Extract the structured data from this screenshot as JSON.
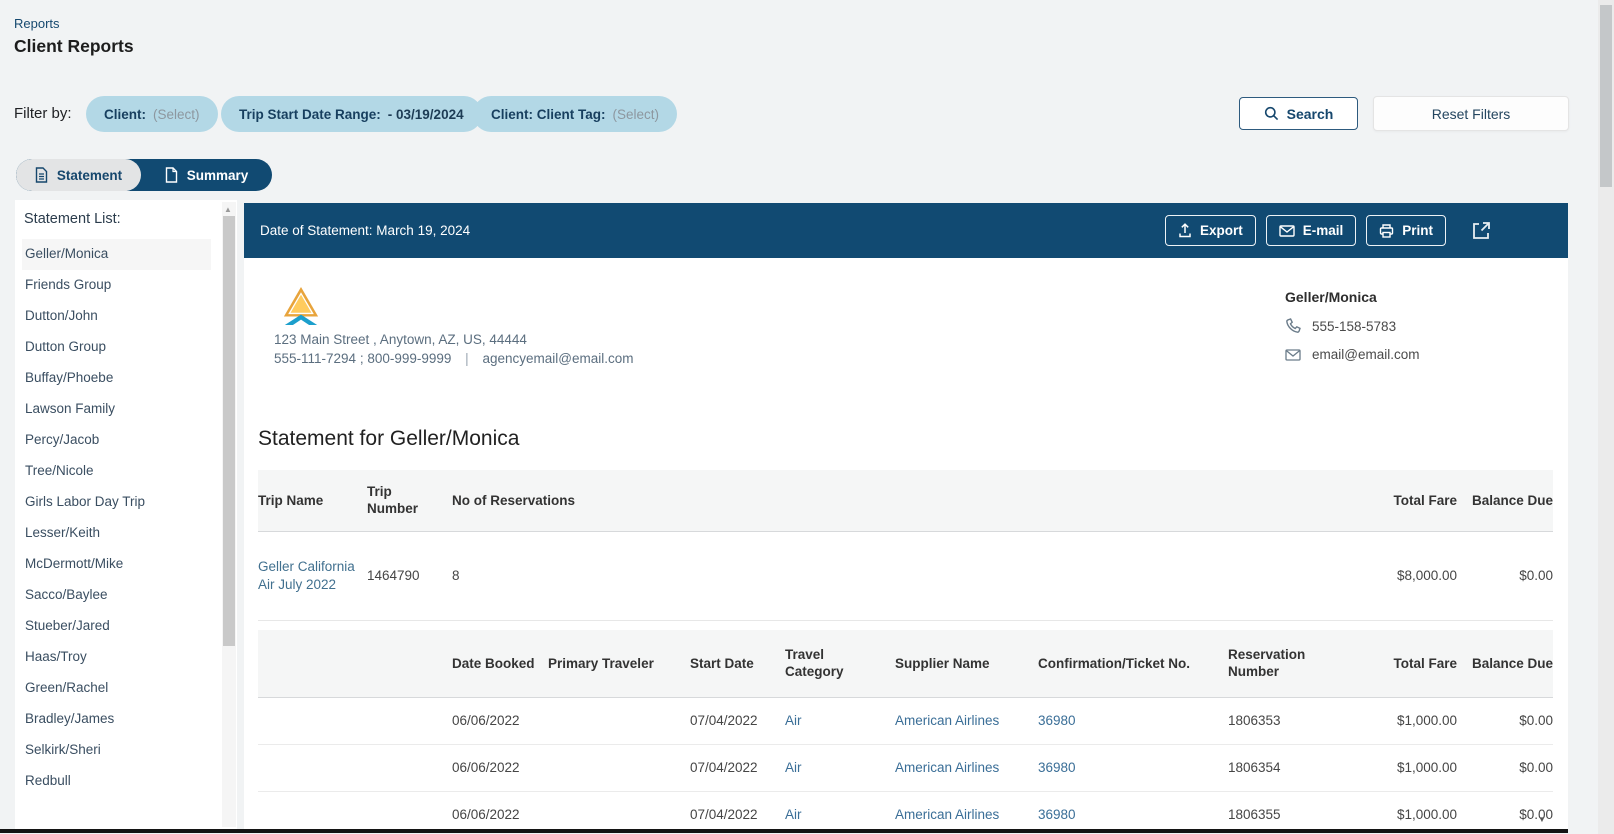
{
  "page": {
    "breadcrumb": "Reports",
    "title": "Client Reports"
  },
  "filters": {
    "label": "Filter by:",
    "client_chip": {
      "label": "Client:",
      "value": "(Select)"
    },
    "date_chip": {
      "label": "Trip Start Date Range:",
      "value": "- 03/19/2024"
    },
    "tag_chip": {
      "label": "Client: Client Tag:",
      "value": "(Select)"
    },
    "search": "Search",
    "reset": "Reset Filters"
  },
  "tabs": {
    "statement": "Statement",
    "summary": "Summary"
  },
  "sidebar": {
    "heading": "Statement List:",
    "selected": "Geller/Monica",
    "items": [
      "Geller/Monica",
      "Friends Group",
      "Dutton/John",
      "Dutton Group",
      "Buffay/Phoebe",
      "Lawson Family",
      "Percy/Jacob",
      "Tree/Nicole",
      "Girls Labor Day Trip",
      "Lesser/Keith",
      "McDermott/Mike",
      "Sacco/Baylee",
      "Stueber/Jared",
      "Haas/Troy",
      "Green/Rachel",
      "Bradley/James",
      "Selkirk/Sheri",
      "Redbull"
    ]
  },
  "statement": {
    "bar": {
      "date": "Date of Statement: March 19, 2024",
      "export": "Export",
      "email": "E-mail",
      "print": "Print"
    },
    "agency": {
      "address": "123 Main Street , Anytown, AZ, US, 44444",
      "phones": "555-111-7294 ; 800-999-9999",
      "separator": "|",
      "email": "agencyemail@email.com"
    },
    "client": {
      "name": "Geller/Monica",
      "phone": "555-158-5783",
      "email": "email@email.com"
    },
    "title": "Statement for Geller/Monica",
    "trip_table": {
      "headers": {
        "trip_name": "Trip Name",
        "trip_number": "Trip Number",
        "reservations": "No of Reservations",
        "total_fare": "Total Fare",
        "balance_due": "Balance Due"
      },
      "row": {
        "trip_name": "Geller California Air July 2022",
        "trip_number": "1464790",
        "reservations": "8",
        "total_fare": "$8,000.00",
        "balance_due": "$0.00"
      }
    },
    "res_table": {
      "headers": {
        "date_booked": "Date Booked",
        "primary_traveler": "Primary Traveler",
        "start_date": "Start Date",
        "travel_category": "Travel Category",
        "supplier": "Supplier Name",
        "confirmation": "Confirmation/Ticket No.",
        "res_number": "Reservation Number",
        "total_fare": "Total Fare",
        "balance_due": "Balance Due"
      },
      "rows": [
        {
          "date_booked": "06/06/2022",
          "primary_traveler": "",
          "start_date": "07/04/2022",
          "travel_category": "Air",
          "supplier": "American Airlines",
          "confirmation": "36980",
          "res_number": "1806353",
          "total_fare": "$1,000.00",
          "balance_due": "$0.00"
        },
        {
          "date_booked": "06/06/2022",
          "primary_traveler": "",
          "start_date": "07/04/2022",
          "travel_category": "Air",
          "supplier": "American Airlines",
          "confirmation": "36980",
          "res_number": "1806354",
          "total_fare": "$1,000.00",
          "balance_due": "$0.00"
        },
        {
          "date_booked": "06/06/2022",
          "primary_traveler": "",
          "start_date": "07/04/2022",
          "travel_category": "Air",
          "supplier": "American Airlines",
          "confirmation": "36980",
          "res_number": "1806355",
          "total_fare": "$1,000.00",
          "balance_due": "$0.00"
        }
      ]
    }
  },
  "colors": {
    "navy": "#114A72",
    "chip_blue": "#B3D8E6",
    "link_blue": "#3A6E97",
    "logo_gold": "#E8A43C",
    "logo_yellow": "#FFCB5E",
    "logo_blue": "#1C9FCC"
  }
}
